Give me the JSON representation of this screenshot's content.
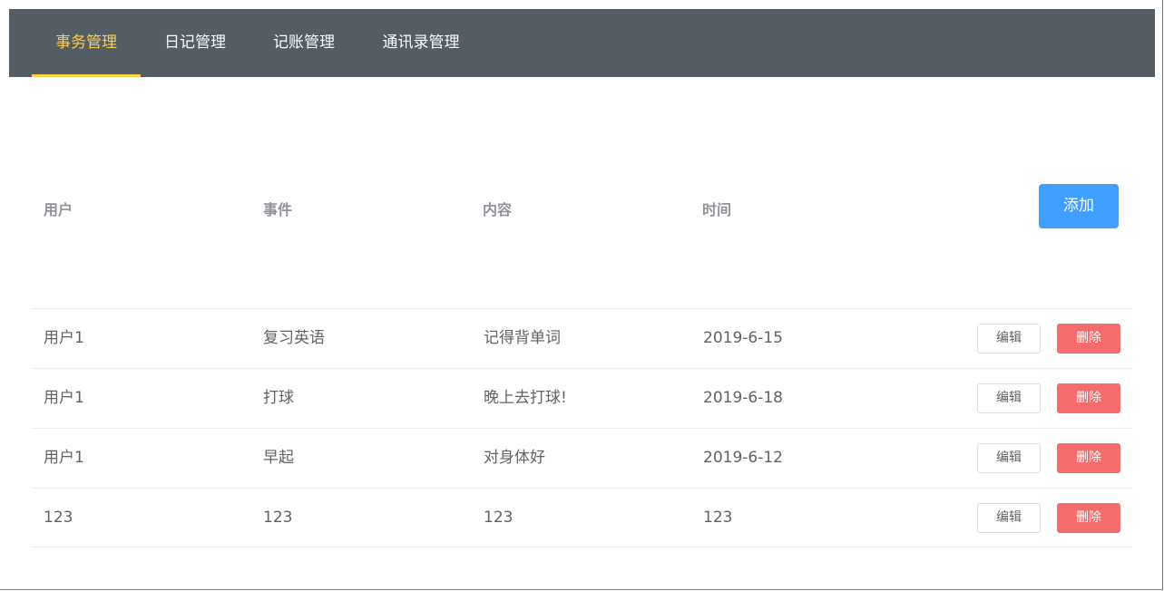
{
  "nav": {
    "items": [
      {
        "label": "事务管理",
        "active": true
      },
      {
        "label": "日记管理",
        "active": false
      },
      {
        "label": "记账管理",
        "active": false
      },
      {
        "label": "通讯录管理",
        "active": false
      }
    ]
  },
  "table": {
    "headers": {
      "user": "用户",
      "event": "事件",
      "content": "内容",
      "time": "时间"
    },
    "add_label": "添加",
    "edit_label": "编辑",
    "delete_label": "删除",
    "rows": [
      {
        "user": "用户1",
        "event": "复习英语",
        "content": "记得背单词",
        "time": "2019-6-15"
      },
      {
        "user": "用户1",
        "event": "打球",
        "content": "晚上去打球!",
        "time": "2019-6-18"
      },
      {
        "user": "用户1",
        "event": "早起",
        "content": "对身体好",
        "time": "2019-6-12"
      },
      {
        "user": "123",
        "event": "123",
        "content": "123",
        "time": "123"
      }
    ]
  },
  "colors": {
    "nav_bg": "#545c64",
    "nav_active": "#ffd04b",
    "primary": "#409eff",
    "danger": "#f56c6c"
  }
}
